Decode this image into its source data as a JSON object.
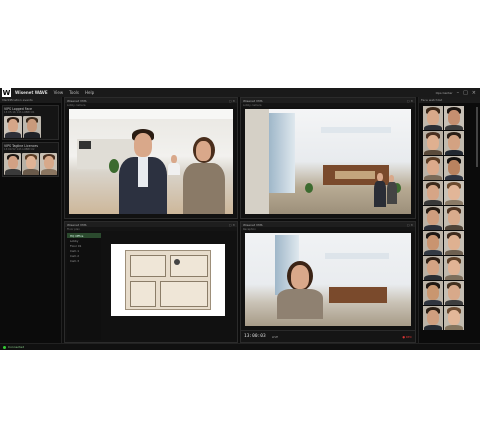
{
  "menubar": {
    "logo": "W",
    "app_title": "Wisenet WAVE",
    "menu": [
      "View",
      "Tools",
      "Help"
    ],
    "user": "Ops Center",
    "window_controls": [
      "–",
      "□",
      "×"
    ]
  },
  "left_panel": {
    "title": "Identification events",
    "alerts": [
      {
        "title": "VIPS Logged Face",
        "sub": "13:05:16  14h  LOBBY-01"
      },
      {
        "title": "VIPS Tagline Licences",
        "sub": "13:04:52  14h  LOBBY-02"
      }
    ]
  },
  "cameras": [
    {
      "title": "Wisenet VMS",
      "sub": "Lobby camera"
    },
    {
      "title": "Wisenet VMS",
      "sub": "Lobby camera"
    },
    {
      "title": "Wisenet VMS",
      "sub": "Floor plan"
    },
    {
      "title": "Wisenet VMS",
      "sub": "Reception"
    }
  ],
  "map": {
    "tree": [
      "HQ Office",
      "Lobby",
      "Floor 01",
      "Cam 1",
      "Cam 2",
      "Cam 3"
    ],
    "selected": "HQ Office"
  },
  "timeline": {
    "time": "13:00:03",
    "sub": "LIVE",
    "rec": "● REC"
  },
  "right_panel": {
    "title": "Face watchlist"
  },
  "status": {
    "text": "Connected"
  },
  "colors": {
    "app_bg": "#0d0d0d",
    "status_green": "#33cc33",
    "rec_red": "#dd3333"
  }
}
